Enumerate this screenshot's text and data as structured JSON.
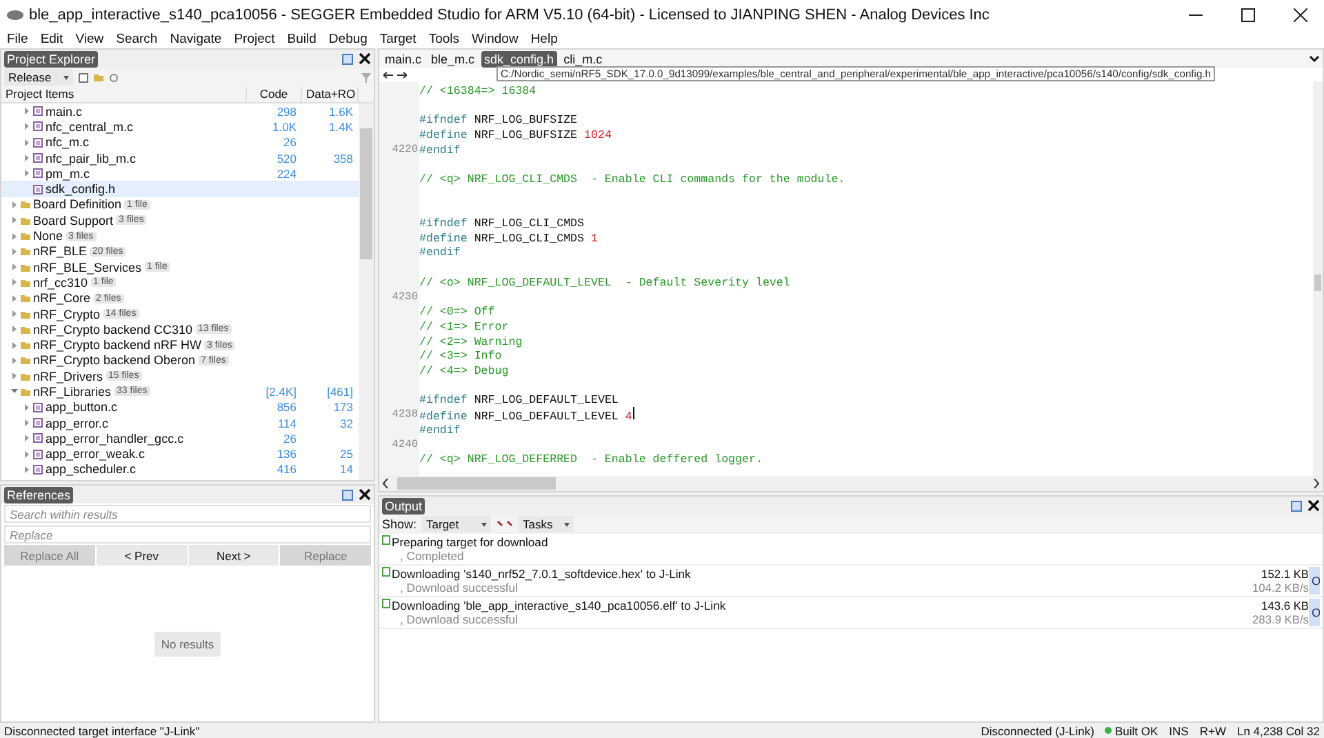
{
  "window": {
    "title": "ble_app_interactive_s140_pca10056 - SEGGER Embedded Studio for ARM V5.10 (64-bit) - Licensed to JIANPING SHEN - Analog Devices Inc"
  },
  "menu": [
    "File",
    "Edit",
    "View",
    "Search",
    "Navigate",
    "Project",
    "Build",
    "Debug",
    "Target",
    "Tools",
    "Window",
    "Help"
  ],
  "project_explorer": {
    "title": "Project Explorer",
    "configuration": "Release",
    "columns": [
      "Project Items",
      "Code",
      "Data+RO"
    ],
    "continued_children": [
      {
        "name": "main.c",
        "code": "298",
        "data": "1.6K",
        "expandable": true,
        "selected": false
      },
      {
        "name": "nfc_central_m.c",
        "code": "1.0K",
        "data": "1.4K",
        "expandable": true,
        "selected": false
      },
      {
        "name": "nfc_m.c",
        "code": "26",
        "expandable": true,
        "selected": false
      },
      {
        "name": "nfc_pair_lib_m.c",
        "code": "520",
        "data": "358",
        "expandable": true,
        "selected": false
      },
      {
        "name": "pm_m.c",
        "code": "224",
        "expandable": true,
        "selected": false
      },
      {
        "name": "sdk_config.h",
        "expandable": false,
        "selected": true
      }
    ],
    "folders": [
      {
        "name": "Board Definition",
        "count": "1 file",
        "expanded": false
      },
      {
        "name": "Board Support",
        "count": "3 files",
        "expanded": false
      },
      {
        "name": "None",
        "count": "3 files",
        "expanded": false
      },
      {
        "name": "nRF_BLE",
        "count": "20 files",
        "expanded": false
      },
      {
        "name": "nRF_BLE_Services",
        "count": "1 file",
        "expanded": false
      },
      {
        "name": "nrf_cc310",
        "count": "1 file",
        "expanded": false
      },
      {
        "name": "nRF_Core",
        "count": "2 files",
        "expanded": false
      },
      {
        "name": "nRF_Crypto",
        "count": "14 files",
        "expanded": false
      },
      {
        "name": "nRF_Crypto backend CC310",
        "count": "13 files",
        "expanded": false
      },
      {
        "name": "nRF_Crypto backend nRF HW",
        "count": "3 files",
        "expanded": false
      },
      {
        "name": "nRF_Crypto backend Oberon",
        "count": "7 files",
        "expanded": false
      },
      {
        "name": "nRF_Drivers",
        "count": "15 files",
        "expanded": false
      },
      {
        "name": "nRF_Libraries",
        "count": "33 files",
        "code": "[2.4K]",
        "data": "[461]",
        "expanded": true,
        "children": [
          {
            "name": "app_button.c",
            "code": "856",
            "data": "173",
            "expandable": true,
            "selected": false
          },
          {
            "name": "app_error.c",
            "code": "114",
            "data": "32",
            "expandable": true,
            "selected": false
          },
          {
            "name": "app_error_handler_gcc.c",
            "code": "26",
            "expandable": true,
            "selected": false
          },
          {
            "name": "app_error_weak.c",
            "code": "136",
            "data": "25",
            "expandable": true,
            "selected": false
          },
          {
            "name": "app_scheduler.c",
            "code": "416",
            "data": "14",
            "expandable": true,
            "selected": false
          }
        ]
      }
    ]
  },
  "references": {
    "title": "References",
    "search_placeholder": "Search within results",
    "replace_placeholder": "Replace",
    "buttons": [
      {
        "label": "Replace All",
        "disabled": true
      },
      {
        "label": "< Prev",
        "disabled": false
      },
      {
        "label": "Next >",
        "disabled": false
      },
      {
        "label": "Replace",
        "disabled": true
      }
    ],
    "empty_message": "No results"
  },
  "editor": {
    "tabs": [
      {
        "label": "main.c",
        "selected": false
      },
      {
        "label": "ble_m.c",
        "selected": false
      },
      {
        "label": "sdk_config.h",
        "selected": true
      },
      {
        "label": "cli_m.c",
        "selected": false
      }
    ],
    "tooltip": "C:/Nordic_semi/nRF5_SDK_17.0.0_9d13099/examples/ble_central_and_peripheral/experimental/ble_app_interactive/pca10056/s140/config/sdk_config.h",
    "lines": [
      {
        "kind": "code",
        "tokens": [
          {
            "kind": "comment",
            "text": "// <16384=> 16384"
          }
        ]
      },
      {
        "kind": "blank"
      },
      {
        "kind": "code",
        "tokens": [
          {
            "kind": "directive",
            "text": "#ifndef"
          },
          {
            "kind": "plain",
            "text": "NRF_LOG_BUFSIZE"
          }
        ]
      },
      {
        "kind": "code",
        "tokens": [
          {
            "kind": "directive",
            "text": "#define"
          },
          {
            "kind": "plain",
            "text": "NRF_LOG_BUFSIZE"
          },
          {
            "kind": "number",
            "text": "1024"
          }
        ]
      },
      {
        "kind": "code",
        "number": "4220",
        "tokens": [
          {
            "kind": "directive",
            "text": "#endif"
          }
        ]
      },
      {
        "kind": "blank"
      },
      {
        "kind": "code",
        "tokens": [
          {
            "kind": "comment",
            "text": "// <q> NRF_LOG_CLI_CMDS  - Enable CLI commands for the module."
          }
        ]
      },
      {
        "kind": "blank"
      },
      {
        "kind": "blank"
      },
      {
        "kind": "code",
        "tokens": [
          {
            "kind": "directive",
            "text": "#ifndef"
          },
          {
            "kind": "plain",
            "text": "NRF_LOG_CLI_CMDS"
          }
        ]
      },
      {
        "kind": "code",
        "tokens": [
          {
            "kind": "directive",
            "text": "#define"
          },
          {
            "kind": "plain",
            "text": "NRF_LOG_CLI_CMDS"
          },
          {
            "kind": "number",
            "text": "1"
          }
        ]
      },
      {
        "kind": "code",
        "tokens": [
          {
            "kind": "directive",
            "text": "#endif"
          }
        ]
      },
      {
        "kind": "blank"
      },
      {
        "kind": "code",
        "tokens": [
          {
            "kind": "comment",
            "text": "// <o> NRF_LOG_DEFAULT_LEVEL  - Default Severity level"
          }
        ]
      },
      {
        "kind": "blank",
        "number": "4230"
      },
      {
        "kind": "code",
        "tokens": [
          {
            "kind": "comment",
            "text": "// <0=> Off"
          }
        ]
      },
      {
        "kind": "code",
        "tokens": [
          {
            "kind": "comment",
            "text": "// <1=> Error"
          }
        ]
      },
      {
        "kind": "code",
        "tokens": [
          {
            "kind": "comment",
            "text": "// <2=> Warning"
          }
        ]
      },
      {
        "kind": "code",
        "tokens": [
          {
            "kind": "comment",
            "text": "// <3=> Info"
          }
        ]
      },
      {
        "kind": "code",
        "tokens": [
          {
            "kind": "comment",
            "text": "// <4=> Debug"
          }
        ]
      },
      {
        "kind": "blank"
      },
      {
        "kind": "code",
        "tokens": [
          {
            "kind": "directive",
            "text": "#ifndef"
          },
          {
            "kind": "plain",
            "text": "NRF_LOG_DEFAULT_LEVEL"
          }
        ]
      },
      {
        "kind": "code",
        "number": "4238",
        "cursor": true,
        "tokens": [
          {
            "kind": "directive",
            "text": "#define"
          },
          {
            "kind": "plain",
            "text": "NRF_LOG_DEFAULT_LEVEL"
          },
          {
            "kind": "number",
            "text": "4"
          }
        ]
      },
      {
        "kind": "code",
        "tokens": [
          {
            "kind": "directive",
            "text": "#endif"
          }
        ]
      },
      {
        "kind": "blank",
        "number": "4240"
      },
      {
        "kind": "code",
        "tokens": [
          {
            "kind": "comment",
            "text": "// <q> NRF_LOG_DEFERRED  - Enable deffered logger."
          }
        ]
      }
    ]
  },
  "output": {
    "title": "Output",
    "show_label": "Show:",
    "show_value": "Target",
    "tasks_value": "Tasks",
    "entries": [
      {
        "title": "Preparing target for download",
        "detail": ", Completed"
      },
      {
        "title": "Downloading 's140_nrf52_7.0.1_softdevice.hex' to J-Link",
        "detail": ", Download successful",
        "size": "152.1 KB",
        "rate": "104.2 KB/s",
        "status": "O"
      },
      {
        "title": "Downloading 'ble_app_interactive_s140_pca10056.elf' to J-Link",
        "detail": ", Download successful",
        "size": "143.6 KB",
        "rate": "283.9 KB/s",
        "status": "O"
      }
    ]
  },
  "status_bar": {
    "message": "Disconnected target interface \"J-Link\"",
    "connection": "Disconnected (J-Link)",
    "build": "Built OK",
    "mode": "INS",
    "access": "R+W",
    "position": "Ln 4,238 Col 32"
  }
}
